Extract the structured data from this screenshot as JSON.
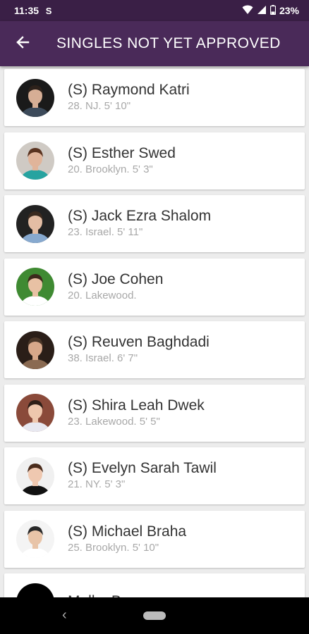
{
  "status_bar": {
    "time": "11:35",
    "app_icon": "S",
    "battery": "23%"
  },
  "app_bar": {
    "title": "SINGLES NOT YET APPROVED",
    "back_icon": "arrow-left-icon"
  },
  "singles": [
    {
      "name": "(S) Raymond Katri",
      "details": "28. NJ. 5' 10\"",
      "avatar_bg": "#1a1a1a",
      "skin": "#d6ae95",
      "hair": "#2c211b",
      "shirt": "#3c4a5a"
    },
    {
      "name": "(S) Esther Swed",
      "details": "20. Brooklyn. 5' 3\"",
      "avatar_bg": "#cfcac4",
      "skin": "#e0b49a",
      "hair": "#5a3320",
      "shirt": "#27a3a0"
    },
    {
      "name": "(S) Jack Ezra Shalom",
      "details": "23. Israel. 5' 11\"",
      "avatar_bg": "#222222",
      "skin": "#e3bda4",
      "hair": "#3a2a1f",
      "shirt": "#87a9cf"
    },
    {
      "name": "(S) Joe Cohen",
      "details": "20. Lakewood.",
      "avatar_bg": "#3f8a32",
      "skin": "#e8c1a4",
      "hair": "#3d2a1c",
      "shirt": "#ffffff"
    },
    {
      "name": "(S) Reuven Baghdadi",
      "details": "38. Israel. 6' 7\"",
      "avatar_bg": "#2a1e18",
      "skin": "#d8a88a",
      "hair": "#4a3628",
      "shirt": "#8a6a52"
    },
    {
      "name": "(S) Shira Leah Dwek",
      "details": "23. Lakewood. 5' 5\"",
      "avatar_bg": "#8a4a3a",
      "skin": "#eec7ad",
      "hair": "#2f1f18",
      "shirt": "#e8e8f0"
    },
    {
      "name": "(S) Evelyn Sarah Tawil",
      "details": "21. NY. 5' 3\"",
      "avatar_bg": "#f0f0f0",
      "skin": "#efc8b0",
      "hair": "#4a2c1c",
      "shirt": "#111111"
    },
    {
      "name": "(S) Michael Braha",
      "details": "25. Brooklyn. 5' 10\"",
      "avatar_bg": "#f4f4f4",
      "skin": "#e8c4a8",
      "hair": "#2a2a2a",
      "shirt": "#ffffff"
    },
    {
      "name": "Malka Berman",
      "details": "",
      "avatar_bg": "#000000",
      "skin": "#000000",
      "hair": "#000000",
      "shirt": "#000000"
    }
  ]
}
